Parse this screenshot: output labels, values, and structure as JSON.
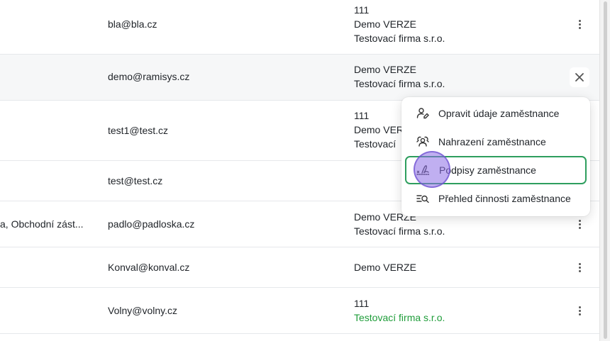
{
  "rows": [
    {
      "role": "",
      "email": "bla@bla.cz",
      "company": [
        "111",
        "Demo VERZE",
        "Testovací firma s.r.o."
      ]
    },
    {
      "role": "",
      "email": "demo@ramisys.cz",
      "company": [
        "Demo VERZE",
        "Testovací firma s.r.o."
      ]
    },
    {
      "role": "",
      "email": "test1@test.cz",
      "company": [
        "111",
        "Demo VER",
        "Testovací"
      ]
    },
    {
      "role": "",
      "email": "test@test.cz",
      "company": []
    },
    {
      "role": "a, Obchodní zást...",
      "email": "padlo@padloska.cz",
      "company": [
        "Demo VERZE",
        "Testovací firma s.r.o."
      ]
    },
    {
      "role": "",
      "email": "Konval@konval.cz",
      "company": [
        "Demo VERZE"
      ]
    },
    {
      "role": "",
      "email": "Volny@volny.cz",
      "company": [
        "111",
        "Testovací firma s.r.o."
      ]
    }
  ],
  "menu": {
    "items": [
      {
        "label": "Opravit údaje zaměstnance",
        "icon": "user-edit-icon"
      },
      {
        "label": "Nahrazení zaměstnance",
        "icon": "users-swap-icon"
      },
      {
        "label": "Podpisy zaměstnance",
        "icon": "signature-icon"
      },
      {
        "label": "Přehled činnosti zaměstnance",
        "icon": "list-search-icon"
      }
    ]
  },
  "colors": {
    "accent_border": "#2e9e5e",
    "green_text": "#1f9d3a",
    "cursor": "#8c6ee6"
  }
}
